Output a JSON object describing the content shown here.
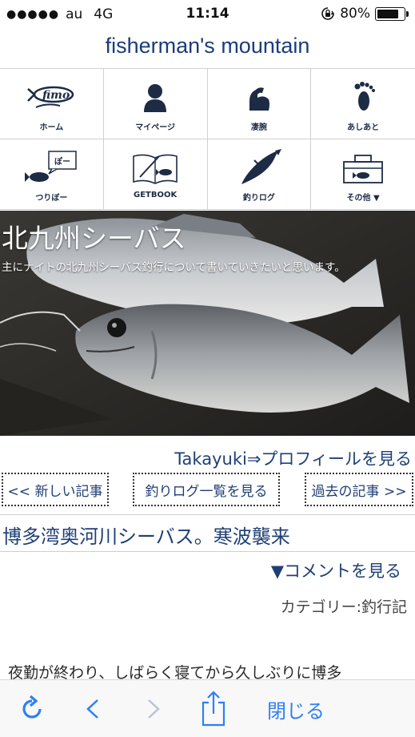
{
  "status_bar": {
    "signal_dots": "●●●●●",
    "carrier": "au",
    "network": "4G",
    "time": "11:14",
    "battery_percent": "80%",
    "battery_level": 0.8
  },
  "site": {
    "title": "fisherman's mountain"
  },
  "nav": {
    "items": [
      {
        "label": "ホーム",
        "icon": "fimo-logo-icon"
      },
      {
        "label": "マイページ",
        "icon": "person-icon"
      },
      {
        "label": "凄腕",
        "icon": "muscle-arm-icon"
      },
      {
        "label": "あしあと",
        "icon": "footprint-icon"
      },
      {
        "label": "つりぼー",
        "icon": "fish-speech-icon",
        "bubble": "ぽー"
      },
      {
        "label": "GETBOOK",
        "icon": "book-fish-icon"
      },
      {
        "label": "釣りログ",
        "icon": "fish-pen-icon"
      },
      {
        "label": "その他 ▼",
        "icon": "tackle-box-icon"
      }
    ]
  },
  "hero": {
    "title": "北九州シーバス",
    "subtitle": "主にナイトの北九州シーバス釣行について書いていきたいと思います。"
  },
  "profile_link": "Takayuki⇒プロフィールを見る",
  "pager": {
    "newer": "<< 新しい記事",
    "list": "釣りログ一覧を見る",
    "older": "過去の記事 >>"
  },
  "post": {
    "title": "博多湾奥河川シーバス。寒波襲来",
    "comment_link": "▼コメントを見る",
    "category": "カテゴリー:釣行記",
    "body_first_line": "夜勤が終わり、しばらく寝てから久しぶりに博多"
  },
  "toolbar": {
    "close_label": "閉じる"
  },
  "colors": {
    "link": "#1f3f74",
    "ios_blue": "#2d7ff9",
    "nav_icon": "#1d2b45"
  }
}
